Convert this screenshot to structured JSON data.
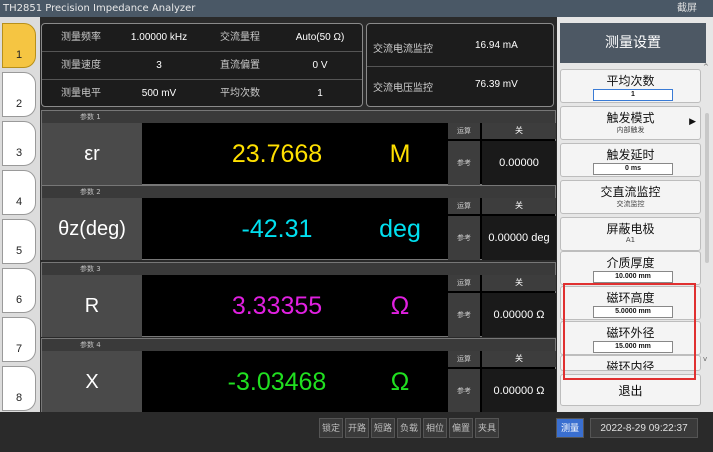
{
  "window": {
    "title": "TH2851 Precision Impedance Analyzer",
    "screenshot_label": "截屏"
  },
  "nav": [
    "1",
    "2",
    "3",
    "4",
    "5",
    "6",
    "7",
    "8"
  ],
  "info": {
    "rows": [
      [
        {
          "label": "测量频率",
          "value": "1.00000 kHz"
        },
        {
          "label": "交流量程",
          "value": "Auto(50 Ω)"
        }
      ],
      [
        {
          "label": "测量速度",
          "value": "3"
        },
        {
          "label": "直流偏置",
          "value": "0 V"
        }
      ],
      [
        {
          "label": "测量电平",
          "value": "500 mV"
        },
        {
          "label": "平均次数",
          "value": "1"
        }
      ]
    ]
  },
  "monitor": {
    "ac_current": {
      "label": "交流电流监控",
      "value": "16.94 mA"
    },
    "ac_voltage": {
      "label": "交流电压监控",
      "value": "76.39 mV"
    }
  },
  "params": [
    {
      "header": "参数 1",
      "name": "εr",
      "value": "23.7668",
      "unit": "M",
      "color": "#ffe000",
      "calc_label": "运算",
      "calc_value": "关",
      "ref_label": "参考",
      "ref_value": "0.00000"
    },
    {
      "header": "参数 2",
      "name": "θz(deg)",
      "value": "-42.31",
      "unit": "deg",
      "color": "#00e0f0",
      "calc_label": "运算",
      "calc_value": "关",
      "ref_label": "参考",
      "ref_value": "0.00000 deg"
    },
    {
      "header": "参数 3",
      "name": "R",
      "value": "3.33355",
      "unit": "Ω",
      "color": "#e020e0",
      "calc_label": "运算",
      "calc_value": "关",
      "ref_label": "参考",
      "ref_value": "0.00000 Ω"
    },
    {
      "header": "参数 4",
      "name": "X",
      "value": "-3.03468",
      "unit": "Ω",
      "color": "#20e020",
      "calc_label": "运算",
      "calc_value": "关",
      "ref_label": "参考",
      "ref_value": "0.00000 Ω"
    }
  ],
  "settings": {
    "title": "测量设置",
    "items": [
      {
        "label": "平均次数",
        "value": "1"
      },
      {
        "label": "触发模式",
        "sub": "内部触发"
      },
      {
        "label": "触发延时",
        "value": "0 ms"
      },
      {
        "label": "交直流监控",
        "sub": "交流监控"
      },
      {
        "label": "屏蔽电极",
        "sub": "A1"
      },
      {
        "label": "介质厚度",
        "value": "10.000 mm"
      },
      {
        "label": "磁环高度",
        "value": "5.0000 mm"
      },
      {
        "label": "磁环外径",
        "value": "15.000 mm"
      },
      {
        "label": "磁环内径"
      }
    ],
    "exit": "退出"
  },
  "bottom": {
    "buttons": [
      "锁定",
      "开路",
      "短路",
      "负载",
      "相位",
      "偏置",
      "夹具"
    ],
    "active": "测量",
    "datetime": "2022-8-29 09:22:37"
  }
}
